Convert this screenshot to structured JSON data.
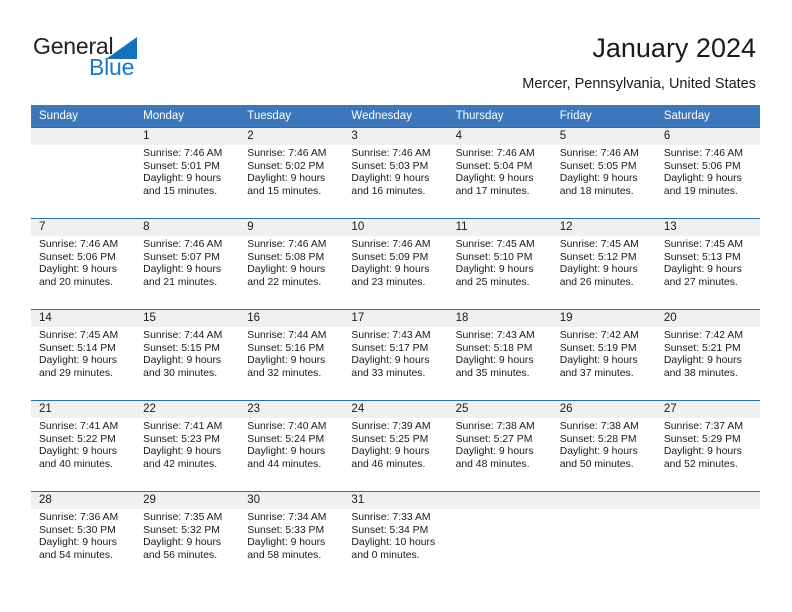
{
  "brand": {
    "name_top": "General",
    "name_bottom": "Blue",
    "accent_color": "#1471bb"
  },
  "header": {
    "title": "January 2024",
    "subtitle": "Mercer, Pennsylvania, United States"
  },
  "calendar": {
    "header_bg": "#3b77ba",
    "row_divider": "#2e6da8",
    "daynum_bg": "#f0f0f0",
    "weekday_headers": [
      "Sunday",
      "Monday",
      "Tuesday",
      "Wednesday",
      "Thursday",
      "Friday",
      "Saturday"
    ],
    "weeks": [
      [
        {
          "day": "",
          "empty": true
        },
        {
          "day": "1",
          "sunrise": "Sunrise: 7:46 AM",
          "sunset": "Sunset: 5:01 PM",
          "daylight1": "Daylight: 9 hours",
          "daylight2": "and 15 minutes."
        },
        {
          "day": "2",
          "sunrise": "Sunrise: 7:46 AM",
          "sunset": "Sunset: 5:02 PM",
          "daylight1": "Daylight: 9 hours",
          "daylight2": "and 15 minutes."
        },
        {
          "day": "3",
          "sunrise": "Sunrise: 7:46 AM",
          "sunset": "Sunset: 5:03 PM",
          "daylight1": "Daylight: 9 hours",
          "daylight2": "and 16 minutes."
        },
        {
          "day": "4",
          "sunrise": "Sunrise: 7:46 AM",
          "sunset": "Sunset: 5:04 PM",
          "daylight1": "Daylight: 9 hours",
          "daylight2": "and 17 minutes."
        },
        {
          "day": "5",
          "sunrise": "Sunrise: 7:46 AM",
          "sunset": "Sunset: 5:05 PM",
          "daylight1": "Daylight: 9 hours",
          "daylight2": "and 18 minutes."
        },
        {
          "day": "6",
          "sunrise": "Sunrise: 7:46 AM",
          "sunset": "Sunset: 5:06 PM",
          "daylight1": "Daylight: 9 hours",
          "daylight2": "and 19 minutes."
        }
      ],
      [
        {
          "day": "7",
          "sunrise": "Sunrise: 7:46 AM",
          "sunset": "Sunset: 5:06 PM",
          "daylight1": "Daylight: 9 hours",
          "daylight2": "and 20 minutes."
        },
        {
          "day": "8",
          "sunrise": "Sunrise: 7:46 AM",
          "sunset": "Sunset: 5:07 PM",
          "daylight1": "Daylight: 9 hours",
          "daylight2": "and 21 minutes."
        },
        {
          "day": "9",
          "sunrise": "Sunrise: 7:46 AM",
          "sunset": "Sunset: 5:08 PM",
          "daylight1": "Daylight: 9 hours",
          "daylight2": "and 22 minutes."
        },
        {
          "day": "10",
          "sunrise": "Sunrise: 7:46 AM",
          "sunset": "Sunset: 5:09 PM",
          "daylight1": "Daylight: 9 hours",
          "daylight2": "and 23 minutes."
        },
        {
          "day": "11",
          "sunrise": "Sunrise: 7:45 AM",
          "sunset": "Sunset: 5:10 PM",
          "daylight1": "Daylight: 9 hours",
          "daylight2": "and 25 minutes."
        },
        {
          "day": "12",
          "sunrise": "Sunrise: 7:45 AM",
          "sunset": "Sunset: 5:12 PM",
          "daylight1": "Daylight: 9 hours",
          "daylight2": "and 26 minutes."
        },
        {
          "day": "13",
          "sunrise": "Sunrise: 7:45 AM",
          "sunset": "Sunset: 5:13 PM",
          "daylight1": "Daylight: 9 hours",
          "daylight2": "and 27 minutes."
        }
      ],
      [
        {
          "day": "14",
          "sunrise": "Sunrise: 7:45 AM",
          "sunset": "Sunset: 5:14 PM",
          "daylight1": "Daylight: 9 hours",
          "daylight2": "and 29 minutes."
        },
        {
          "day": "15",
          "sunrise": "Sunrise: 7:44 AM",
          "sunset": "Sunset: 5:15 PM",
          "daylight1": "Daylight: 9 hours",
          "daylight2": "and 30 minutes."
        },
        {
          "day": "16",
          "sunrise": "Sunrise: 7:44 AM",
          "sunset": "Sunset: 5:16 PM",
          "daylight1": "Daylight: 9 hours",
          "daylight2": "and 32 minutes."
        },
        {
          "day": "17",
          "sunrise": "Sunrise: 7:43 AM",
          "sunset": "Sunset: 5:17 PM",
          "daylight1": "Daylight: 9 hours",
          "daylight2": "and 33 minutes."
        },
        {
          "day": "18",
          "sunrise": "Sunrise: 7:43 AM",
          "sunset": "Sunset: 5:18 PM",
          "daylight1": "Daylight: 9 hours",
          "daylight2": "and 35 minutes."
        },
        {
          "day": "19",
          "sunrise": "Sunrise: 7:42 AM",
          "sunset": "Sunset: 5:19 PM",
          "daylight1": "Daylight: 9 hours",
          "daylight2": "and 37 minutes."
        },
        {
          "day": "20",
          "sunrise": "Sunrise: 7:42 AM",
          "sunset": "Sunset: 5:21 PM",
          "daylight1": "Daylight: 9 hours",
          "daylight2": "and 38 minutes."
        }
      ],
      [
        {
          "day": "21",
          "sunrise": "Sunrise: 7:41 AM",
          "sunset": "Sunset: 5:22 PM",
          "daylight1": "Daylight: 9 hours",
          "daylight2": "and 40 minutes."
        },
        {
          "day": "22",
          "sunrise": "Sunrise: 7:41 AM",
          "sunset": "Sunset: 5:23 PM",
          "daylight1": "Daylight: 9 hours",
          "daylight2": "and 42 minutes."
        },
        {
          "day": "23",
          "sunrise": "Sunrise: 7:40 AM",
          "sunset": "Sunset: 5:24 PM",
          "daylight1": "Daylight: 9 hours",
          "daylight2": "and 44 minutes."
        },
        {
          "day": "24",
          "sunrise": "Sunrise: 7:39 AM",
          "sunset": "Sunset: 5:25 PM",
          "daylight1": "Daylight: 9 hours",
          "daylight2": "and 46 minutes."
        },
        {
          "day": "25",
          "sunrise": "Sunrise: 7:38 AM",
          "sunset": "Sunset: 5:27 PM",
          "daylight1": "Daylight: 9 hours",
          "daylight2": "and 48 minutes."
        },
        {
          "day": "26",
          "sunrise": "Sunrise: 7:38 AM",
          "sunset": "Sunset: 5:28 PM",
          "daylight1": "Daylight: 9 hours",
          "daylight2": "and 50 minutes."
        },
        {
          "day": "27",
          "sunrise": "Sunrise: 7:37 AM",
          "sunset": "Sunset: 5:29 PM",
          "daylight1": "Daylight: 9 hours",
          "daylight2": "and 52 minutes."
        }
      ],
      [
        {
          "day": "28",
          "sunrise": "Sunrise: 7:36 AM",
          "sunset": "Sunset: 5:30 PM",
          "daylight1": "Daylight: 9 hours",
          "daylight2": "and 54 minutes."
        },
        {
          "day": "29",
          "sunrise": "Sunrise: 7:35 AM",
          "sunset": "Sunset: 5:32 PM",
          "daylight1": "Daylight: 9 hours",
          "daylight2": "and 56 minutes."
        },
        {
          "day": "30",
          "sunrise": "Sunrise: 7:34 AM",
          "sunset": "Sunset: 5:33 PM",
          "daylight1": "Daylight: 9 hours",
          "daylight2": "and 58 minutes."
        },
        {
          "day": "31",
          "sunrise": "Sunrise: 7:33 AM",
          "sunset": "Sunset: 5:34 PM",
          "daylight1": "Daylight: 10 hours",
          "daylight2": "and 0 minutes."
        },
        {
          "day": "",
          "empty": true
        },
        {
          "day": "",
          "empty": true
        },
        {
          "day": "",
          "empty": true
        }
      ]
    ]
  }
}
